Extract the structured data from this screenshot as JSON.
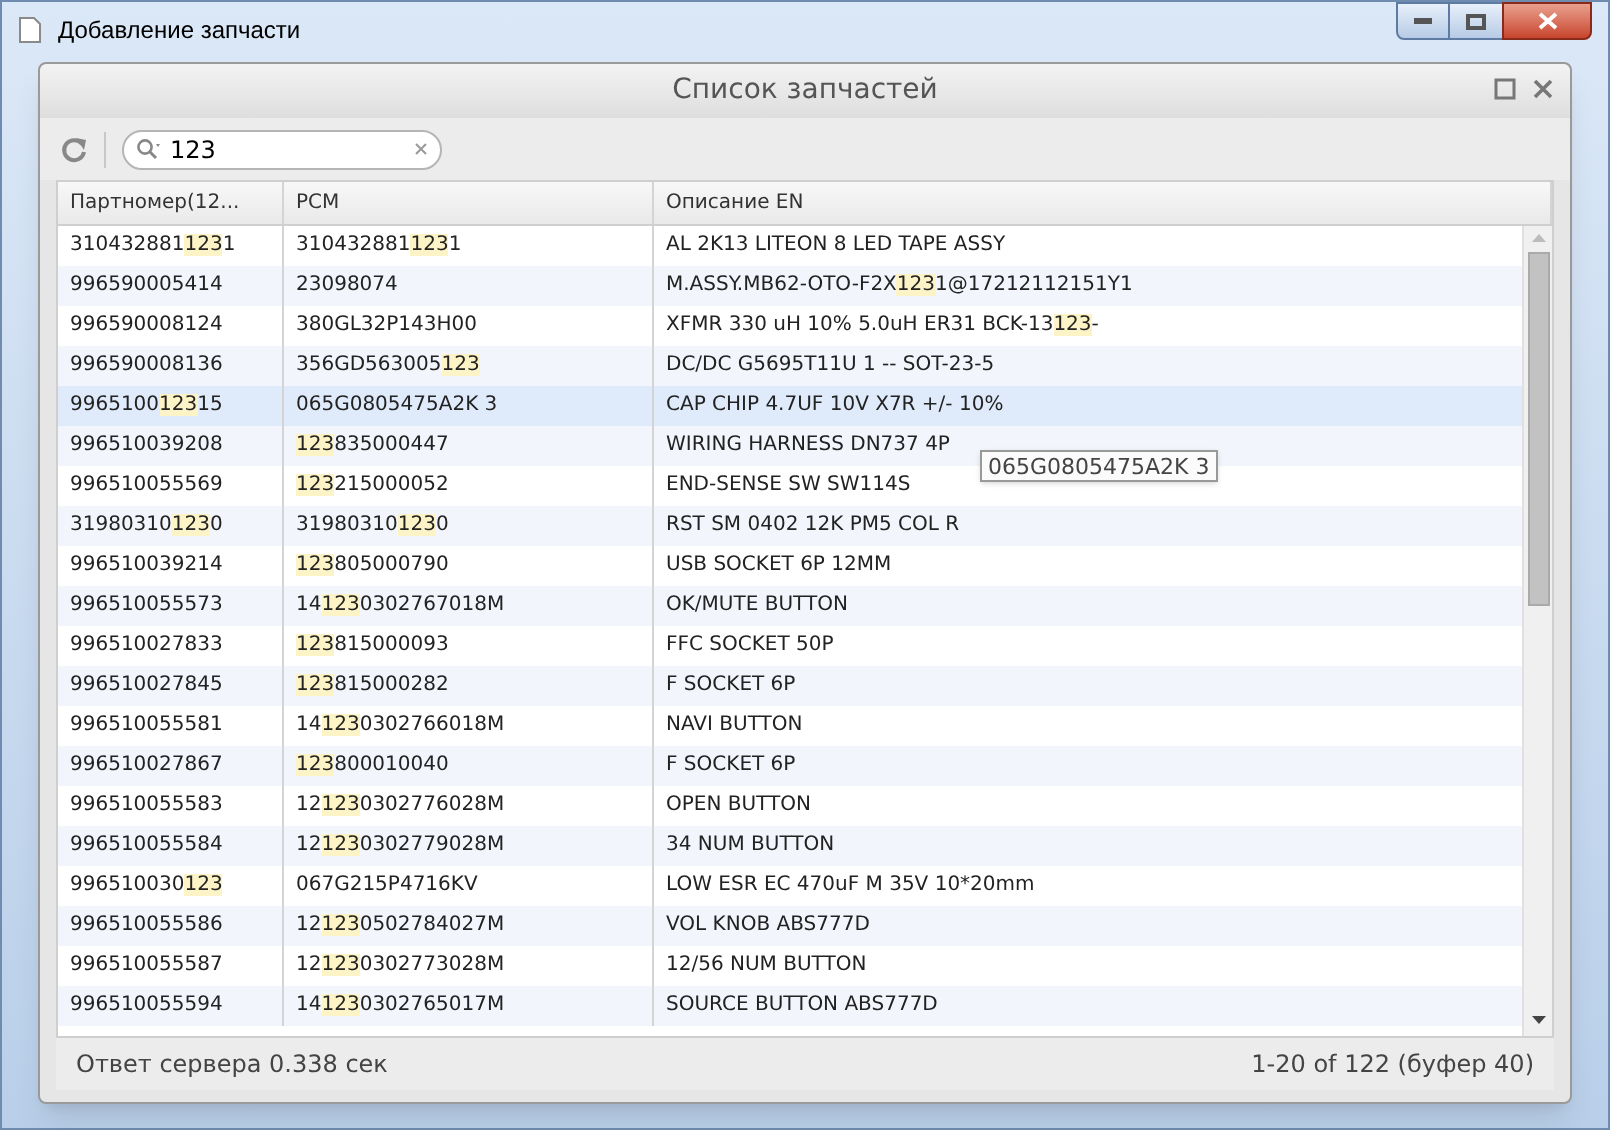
{
  "window": {
    "title": "Добавление запчасти"
  },
  "dialog": {
    "title": "Список запчастей"
  },
  "search": {
    "value": "123"
  },
  "table": {
    "columns": [
      "Партномер(12...",
      "PCM",
      "Описание EN"
    ],
    "rows": [
      {
        "selected": false,
        "cells": [
          [
            {
              "text": "310432881",
              "hl": false
            },
            {
              "text": "123",
              "hl": true
            },
            {
              "text": "1",
              "hl": false
            }
          ],
          [
            {
              "text": "310432881",
              "hl": false
            },
            {
              "text": "123",
              "hl": true
            },
            {
              "text": "1",
              "hl": false
            }
          ],
          [
            {
              "text": "AL 2K13 LITEON 8 LED TAPE ASSY",
              "hl": false
            }
          ]
        ]
      },
      {
        "selected": false,
        "cells": [
          [
            {
              "text": "996590005414",
              "hl": false
            }
          ],
          [
            {
              "text": "23098074",
              "hl": false
            }
          ],
          [
            {
              "text": "M.ASSY.MB62-OTO-F2X",
              "hl": false
            },
            {
              "text": "123",
              "hl": true
            },
            {
              "text": "1@17212112151Y1",
              "hl": false
            }
          ]
        ]
      },
      {
        "selected": false,
        "cells": [
          [
            {
              "text": "996590008124",
              "hl": false
            }
          ],
          [
            {
              "text": "380GL32P143H00",
              "hl": false
            }
          ],
          [
            {
              "text": "XFMR 330 uH 10% 5.0uH ER31 BCK-13",
              "hl": false
            },
            {
              "text": "123",
              "hl": true
            },
            {
              "text": "-",
              "hl": false
            }
          ]
        ]
      },
      {
        "selected": false,
        "cells": [
          [
            {
              "text": "996590008136",
              "hl": false
            }
          ],
          [
            {
              "text": "356GD563005",
              "hl": false
            },
            {
              "text": "123",
              "hl": true
            }
          ],
          [
            {
              "text": "DC/DC G5695T11U 1 -- SOT-23-5",
              "hl": false
            }
          ]
        ]
      },
      {
        "selected": true,
        "cells": [
          [
            {
              "text": "9965100",
              "hl": false
            },
            {
              "text": "123",
              "hl": true
            },
            {
              "text": "15",
              "hl": false
            }
          ],
          [
            {
              "text": "065G0805475A2K 3",
              "hl": false
            }
          ],
          [
            {
              "text": "CAP CHIP 4.7UF 10V X7R +/- 10%",
              "hl": false
            }
          ]
        ]
      },
      {
        "selected": false,
        "cells": [
          [
            {
              "text": "996510039208",
              "hl": false
            }
          ],
          [
            {
              "text": "123",
              "hl": true
            },
            {
              "text": "835000447",
              "hl": false
            }
          ],
          [
            {
              "text": "WIRING HARNESS DN737 4P",
              "hl": false
            }
          ]
        ]
      },
      {
        "selected": false,
        "cells": [
          [
            {
              "text": "996510055569",
              "hl": false
            }
          ],
          [
            {
              "text": "123",
              "hl": true
            },
            {
              "text": "215000052",
              "hl": false
            }
          ],
          [
            {
              "text": "END-SENSE SW SW114S",
              "hl": false
            }
          ]
        ]
      },
      {
        "selected": false,
        "cells": [
          [
            {
              "text": "31980310",
              "hl": false
            },
            {
              "text": "123",
              "hl": true
            },
            {
              "text": "0",
              "hl": false
            }
          ],
          [
            {
              "text": "31980310",
              "hl": false
            },
            {
              "text": "123",
              "hl": true
            },
            {
              "text": "0",
              "hl": false
            }
          ],
          [
            {
              "text": "RST SM 0402 12K PM5 COL R",
              "hl": false
            }
          ]
        ]
      },
      {
        "selected": false,
        "cells": [
          [
            {
              "text": "996510039214",
              "hl": false
            }
          ],
          [
            {
              "text": "123",
              "hl": true
            },
            {
              "text": "805000790",
              "hl": false
            }
          ],
          [
            {
              "text": "USB SOCKET 6P 12MM",
              "hl": false
            }
          ]
        ]
      },
      {
        "selected": false,
        "cells": [
          [
            {
              "text": "996510055573",
              "hl": false
            }
          ],
          [
            {
              "text": "14",
              "hl": false
            },
            {
              "text": "123",
              "hl": true
            },
            {
              "text": "0302767018M",
              "hl": false
            }
          ],
          [
            {
              "text": "OK/MUTE BUTTON",
              "hl": false
            }
          ]
        ]
      },
      {
        "selected": false,
        "cells": [
          [
            {
              "text": "996510027833",
              "hl": false
            }
          ],
          [
            {
              "text": "123",
              "hl": true
            },
            {
              "text": "815000093",
              "hl": false
            }
          ],
          [
            {
              "text": "FFC SOCKET 50P",
              "hl": false
            }
          ]
        ]
      },
      {
        "selected": false,
        "cells": [
          [
            {
              "text": "996510027845",
              "hl": false
            }
          ],
          [
            {
              "text": "123",
              "hl": true
            },
            {
              "text": "815000282",
              "hl": false
            }
          ],
          [
            {
              "text": "F SOCKET 6P",
              "hl": false
            }
          ]
        ]
      },
      {
        "selected": false,
        "cells": [
          [
            {
              "text": "996510055581",
              "hl": false
            }
          ],
          [
            {
              "text": "14",
              "hl": false
            },
            {
              "text": "123",
              "hl": true
            },
            {
              "text": "0302766018M",
              "hl": false
            }
          ],
          [
            {
              "text": "NAVI BUTTON",
              "hl": false
            }
          ]
        ]
      },
      {
        "selected": false,
        "cells": [
          [
            {
              "text": "996510027867",
              "hl": false
            }
          ],
          [
            {
              "text": "123",
              "hl": true
            },
            {
              "text": "800010040",
              "hl": false
            }
          ],
          [
            {
              "text": "F SOCKET 6P",
              "hl": false
            }
          ]
        ]
      },
      {
        "selected": false,
        "cells": [
          [
            {
              "text": "996510055583",
              "hl": false
            }
          ],
          [
            {
              "text": "12",
              "hl": false
            },
            {
              "text": "123",
              "hl": true
            },
            {
              "text": "0302776028M",
              "hl": false
            }
          ],
          [
            {
              "text": "OPEN BUTTON",
              "hl": false
            }
          ]
        ]
      },
      {
        "selected": false,
        "cells": [
          [
            {
              "text": "996510055584",
              "hl": false
            }
          ],
          [
            {
              "text": "12",
              "hl": false
            },
            {
              "text": "123",
              "hl": true
            },
            {
              "text": "0302779028M",
              "hl": false
            }
          ],
          [
            {
              "text": "34 NUM BUTTON",
              "hl": false
            }
          ]
        ]
      },
      {
        "selected": false,
        "cells": [
          [
            {
              "text": "996510030",
              "hl": false
            },
            {
              "text": "123",
              "hl": true
            }
          ],
          [
            {
              "text": "067G215P4716KV",
              "hl": false
            }
          ],
          [
            {
              "text": "LOW ESR EC 470uF M 35V 10*20mm",
              "hl": false
            }
          ]
        ]
      },
      {
        "selected": false,
        "cells": [
          [
            {
              "text": "996510055586",
              "hl": false
            }
          ],
          [
            {
              "text": "12",
              "hl": false
            },
            {
              "text": "123",
              "hl": true
            },
            {
              "text": "0502784027M",
              "hl": false
            }
          ],
          [
            {
              "text": "VOL KNOB ABS777D",
              "hl": false
            }
          ]
        ]
      },
      {
        "selected": false,
        "cells": [
          [
            {
              "text": "996510055587",
              "hl": false
            }
          ],
          [
            {
              "text": "12",
              "hl": false
            },
            {
              "text": "123",
              "hl": true
            },
            {
              "text": "0302773028M",
              "hl": false
            }
          ],
          [
            {
              "text": "12/56 NUM BUTTON",
              "hl": false
            }
          ]
        ]
      },
      {
        "selected": false,
        "cells": [
          [
            {
              "text": "996510055594",
              "hl": false
            }
          ],
          [
            {
              "text": "14",
              "hl": false
            },
            {
              "text": "123",
              "hl": true
            },
            {
              "text": "0302765017M",
              "hl": false
            }
          ],
          [
            {
              "text": "SOURCE BUTTON ABS777D",
              "hl": false
            }
          ]
        ]
      }
    ]
  },
  "tooltip": {
    "text": "065G0805475A2K  3"
  },
  "status_bar": {
    "left": "Ответ сервера 0.338 сек",
    "right": "1-20 of 122 (буфер 40)"
  }
}
